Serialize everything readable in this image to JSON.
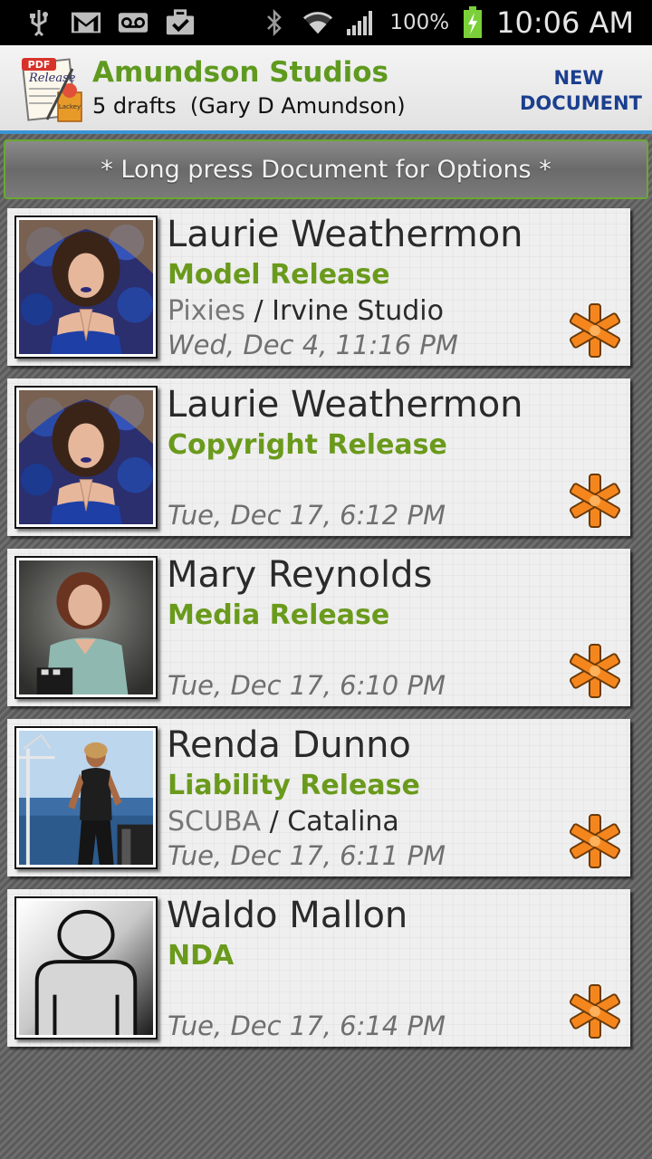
{
  "status_bar": {
    "battery": "100%",
    "time": "10:06 AM",
    "icons": [
      "usb-icon",
      "gmail-icon",
      "voicemail-icon",
      "briefcase-check-icon",
      "bluetooth-icon",
      "wifi-icon",
      "signal-icon",
      "battery-charging-icon"
    ]
  },
  "header": {
    "title": "Amundson Studios",
    "subtitle": "5 drafts  (Gary D Amundson)",
    "new_document_line1": "NEW",
    "new_document_line2": "DOCUMENT",
    "accent_color": "#5f9a1f",
    "link_color": "#1b3f8f"
  },
  "hint": "* Long press Document for Options *",
  "documents": [
    {
      "name": "Laurie Weathermon",
      "type": "Model Release",
      "detail_primary": "Pixies",
      "detail_sep": " / ",
      "detail_secondary": "Irvine Studio",
      "date": "Wed, Dec 4, 11:16 PM",
      "thumbnail": "woman-dark-hair-portrait"
    },
    {
      "name": "Laurie Weathermon",
      "type": "Copyright Release",
      "detail_primary": "",
      "detail_sep": "",
      "detail_secondary": "",
      "date": "Tue, Dec 17, 6:12 PM",
      "thumbnail": "woman-dark-hair-portrait"
    },
    {
      "name": "Mary Reynolds",
      "type": "Media Release",
      "detail_primary": "",
      "detail_sep": "",
      "detail_secondary": "",
      "date": "Tue, Dec 17, 6:10 PM",
      "thumbnail": "woman-red-hair-portrait"
    },
    {
      "name": "Renda Dunno",
      "type": "Liability Release",
      "detail_primary": "SCUBA",
      "detail_sep": " / ",
      "detail_secondary": "Catalina",
      "date": "Tue, Dec 17, 6:11 PM",
      "thumbnail": "woman-on-boat-photo"
    },
    {
      "name": "Waldo Mallon",
      "type": "NDA",
      "detail_primary": "",
      "detail_sep": "",
      "detail_secondary": "",
      "date": "Tue, Dec 17, 6:14 PM",
      "thumbnail": "placeholder-person-silhouette"
    }
  ]
}
